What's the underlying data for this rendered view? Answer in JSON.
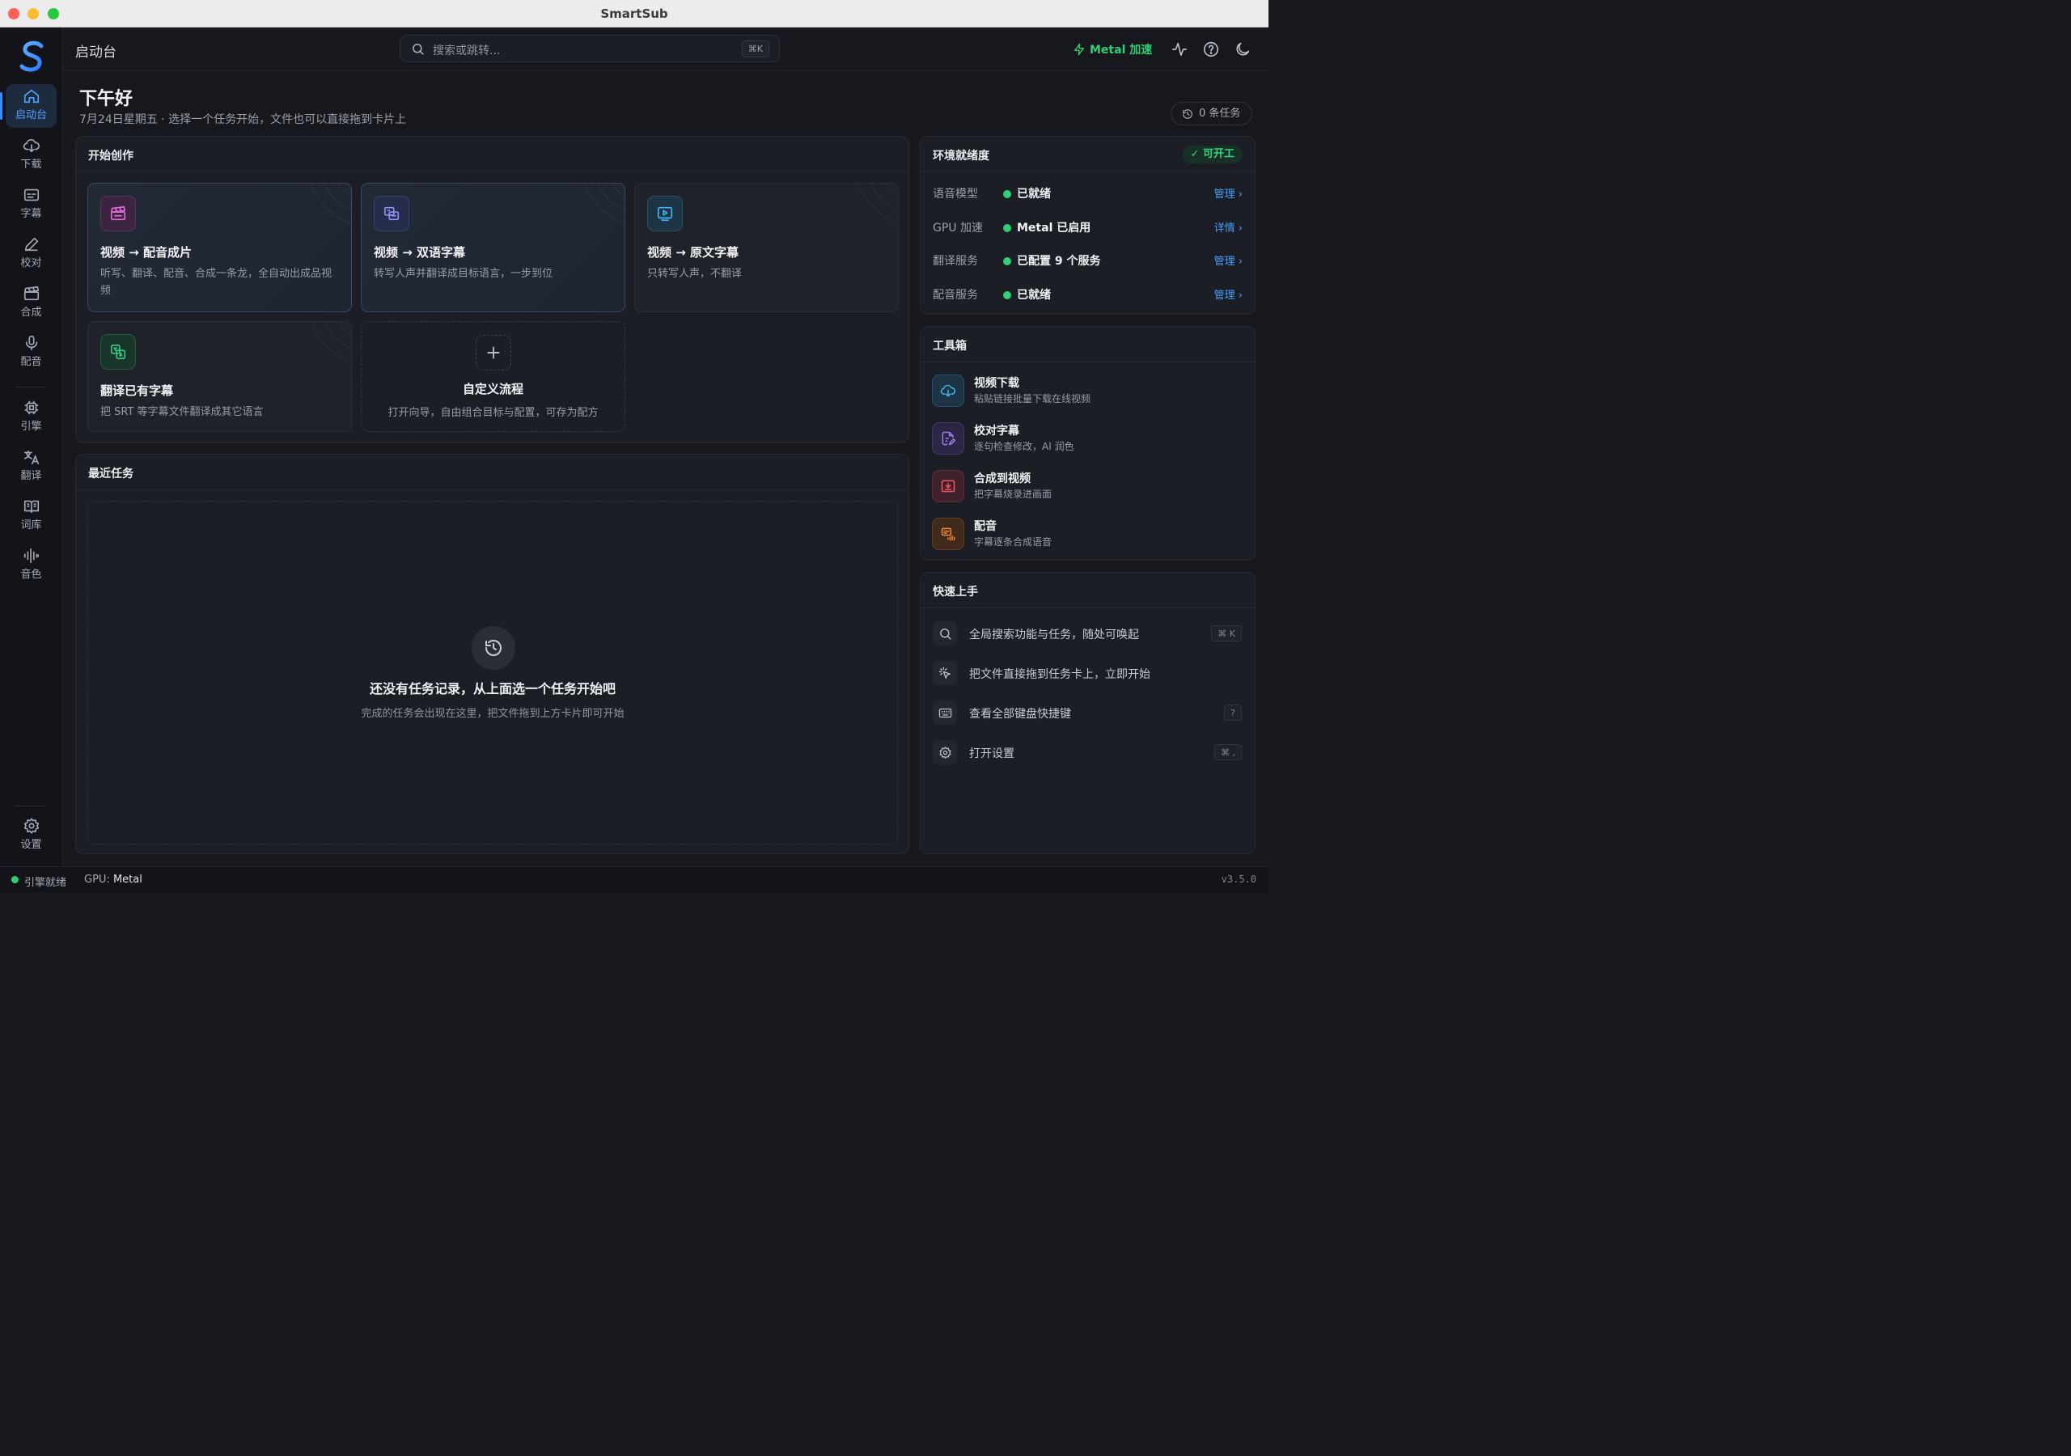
{
  "window": {
    "title": "SmartSub"
  },
  "sidebar": {
    "items": [
      {
        "label": "启动台",
        "icon": "home-icon",
        "active": true
      },
      {
        "label": "下载",
        "icon": "download-icon"
      },
      {
        "label": "字幕",
        "icon": "subtitle-icon"
      },
      {
        "label": "校对",
        "icon": "pen-icon"
      },
      {
        "label": "合成",
        "icon": "clapper-icon"
      },
      {
        "label": "配音",
        "icon": "mic-icon"
      },
      {
        "label": "引擎",
        "icon": "chip-icon"
      },
      {
        "label": "翻译",
        "icon": "translate-icon"
      },
      {
        "label": "词库",
        "icon": "book-icon"
      },
      {
        "label": "音色",
        "icon": "waveform-icon"
      }
    ],
    "settings_label": "设置"
  },
  "topbar": {
    "breadcrumb": "启动台",
    "search_placeholder": "搜索或跳转...",
    "search_shortcut": "⌘K",
    "accel_label": "Metal 加速"
  },
  "header": {
    "greeting": "下午好",
    "subtitle": "7月24日星期五 · 选择一个任务开始，文件也可以直接拖到卡片上",
    "tasks_count": "0 条任务"
  },
  "create": {
    "title": "开始创作",
    "cards": [
      {
        "title": "视频 → 配音成片",
        "desc": "听写、翻译、配音、合成一条龙，全自动出成品视频",
        "icon": "clapper-icon",
        "color": "#e06ad8"
      },
      {
        "title": "视频 → 双语字幕",
        "desc": "转写人声并翻译成目标语言，一步到位",
        "icon": "dual-subtitle-icon",
        "color": "#8a93f5"
      },
      {
        "title": "视频 → 原文字幕",
        "desc": "只转写人声，不翻译",
        "icon": "screen-play-icon",
        "color": "#3fb6f0"
      },
      {
        "title": "翻译已有字幕",
        "desc": "把 SRT 等字幕文件翻译成其它语言",
        "icon": "translate-icon",
        "color": "#34c987"
      }
    ],
    "custom": {
      "title": "自定义流程",
      "desc": "打开向导，自由组合目标与配置，可存为配方"
    }
  },
  "recent": {
    "title": "最近任务",
    "empty_title": "还没有任务记录，从上面选一个任务开始吧",
    "empty_sub": "完成的任务会出现在这里，把文件拖到上方卡片即可开始"
  },
  "env": {
    "title": "环境就绪度",
    "status": "可开工",
    "rows": [
      {
        "key": "语音模型",
        "value": "已就绪",
        "action": "管理 ›"
      },
      {
        "key": "GPU 加速",
        "value": "Metal 已启用",
        "action": "详情 ›"
      },
      {
        "key": "翻译服务",
        "value": "已配置 9 个服务",
        "action": "管理 ›"
      },
      {
        "key": "配音服务",
        "value": "已就绪",
        "action": "管理 ›"
      }
    ]
  },
  "toolbox": {
    "title": "工具箱",
    "items": [
      {
        "title": "视频下载",
        "desc": "粘贴链接批量下载在线视频",
        "icon": "cloud-download-icon",
        "color": "#3fb6f0"
      },
      {
        "title": "校对字幕",
        "desc": "逐句检查修改，AI 润色",
        "icon": "doc-edit-icon",
        "color": "#9b7cf0"
      },
      {
        "title": "合成到视频",
        "desc": "把字幕烧录进画面",
        "icon": "burn-in-icon",
        "color": "#f0556b"
      },
      {
        "title": "配音",
        "desc": "字幕逐条合成语音",
        "icon": "voice-icon",
        "color": "#f08a3a"
      }
    ]
  },
  "quickstart": {
    "title": "快速上手",
    "items": [
      {
        "text": "全局搜索功能与任务，随处可唤起",
        "key": "⌘ K",
        "icon": "search-icon"
      },
      {
        "text": "把文件直接拖到任务卡上，立即开始",
        "key": "",
        "icon": "cursor-click-icon"
      },
      {
        "text": "查看全部键盘快捷键",
        "key": "?",
        "icon": "keyboard-icon"
      },
      {
        "text": "打开设置",
        "key": "⌘ ,",
        "icon": "gear-icon"
      }
    ]
  },
  "statusbar": {
    "engine": "引擎就绪",
    "gpu_label": "GPU:",
    "gpu_value": "Metal",
    "version": "v3.5.0"
  },
  "colors": {
    "accent": "#4a9eff",
    "ok": "#2fd076",
    "bg": "#16181d",
    "panel": "#1b1e24"
  }
}
